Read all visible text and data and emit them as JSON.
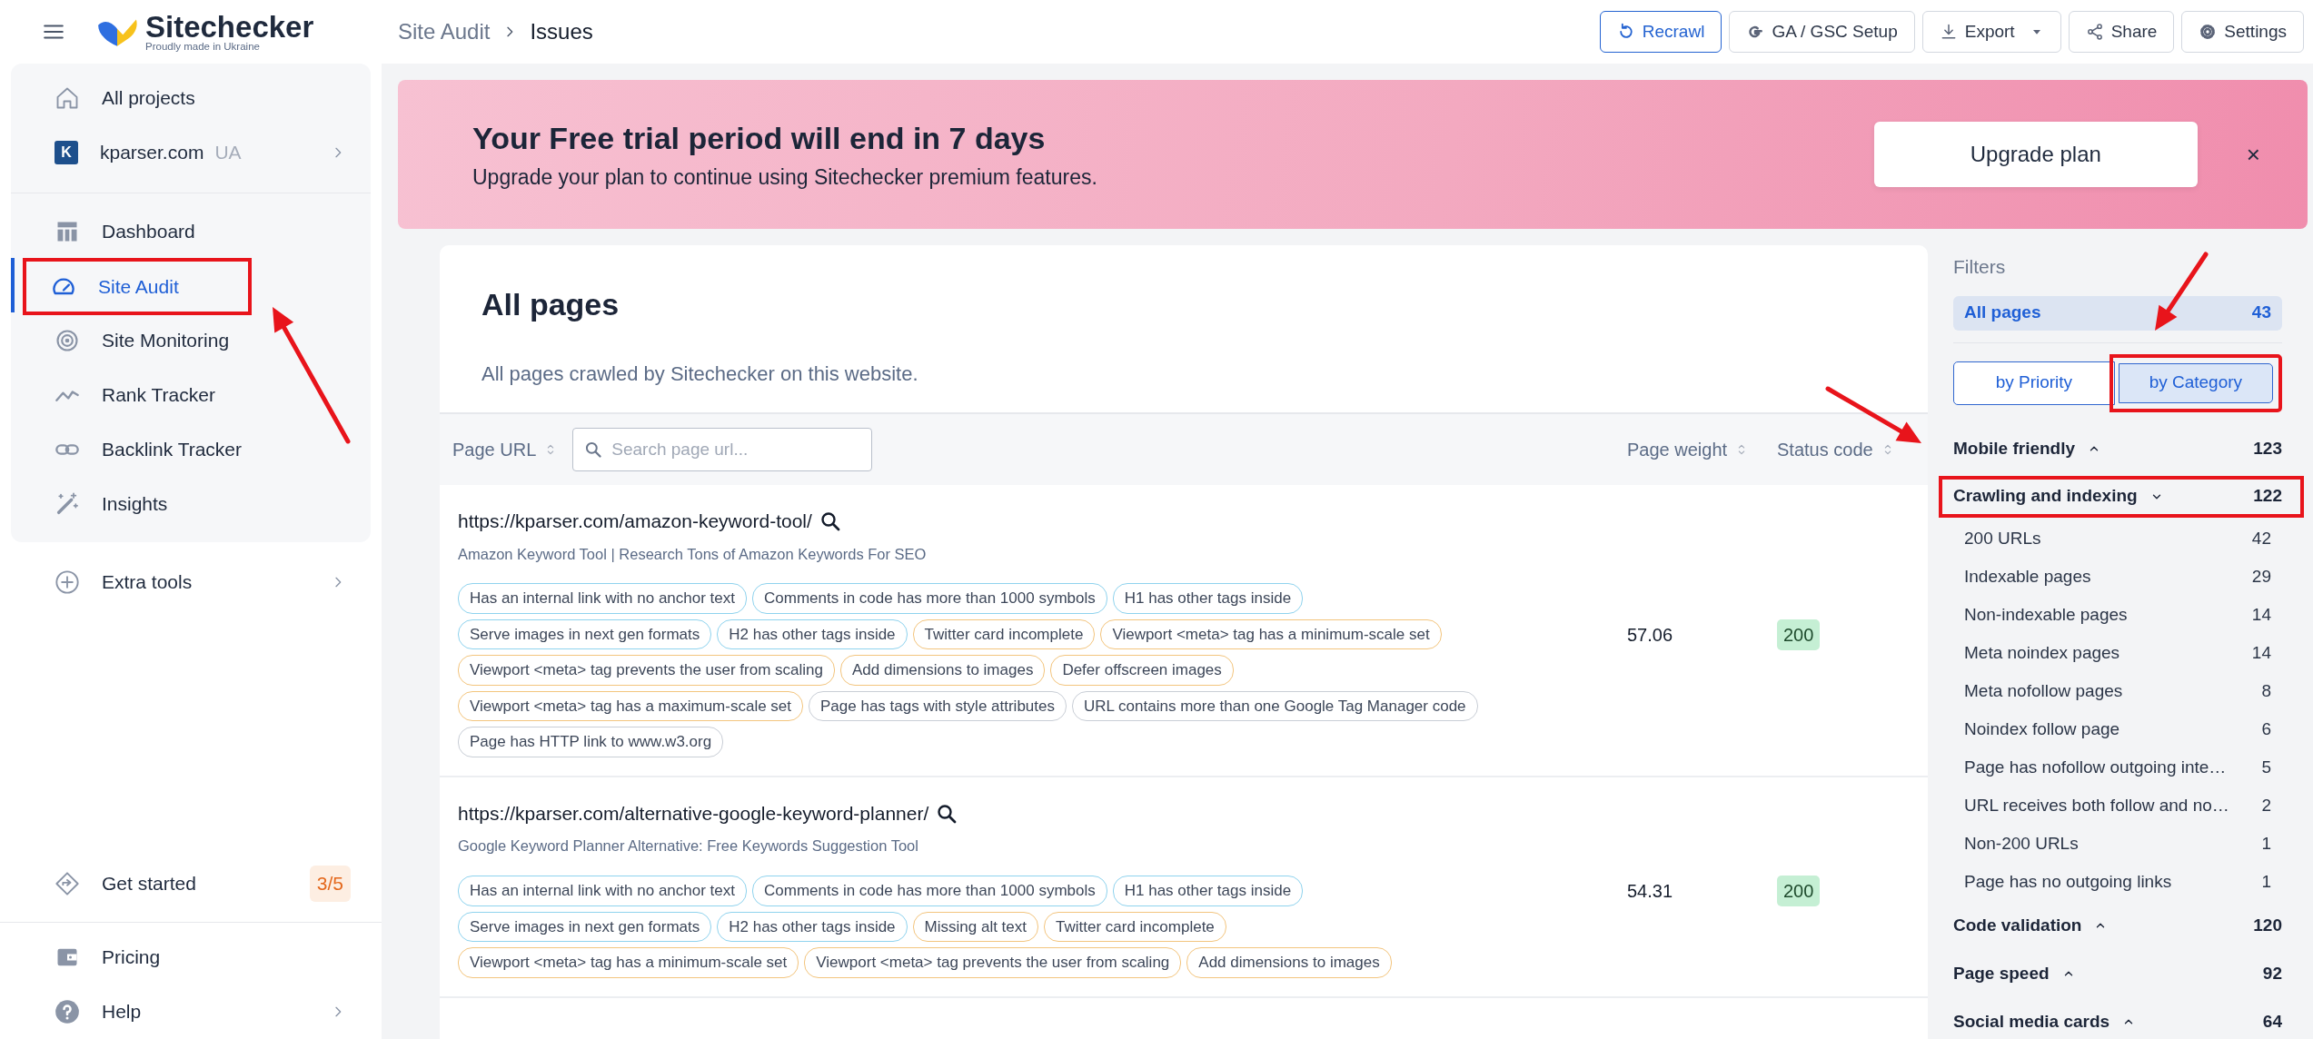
{
  "header": {
    "brand": "Sitechecker",
    "tagline": "Proudly made in Ukraine",
    "breadcrumb": [
      "Site Audit",
      "Issues"
    ],
    "buttons": [
      {
        "label": "Recrawl",
        "kind": "refresh",
        "primary": true
      },
      {
        "label": "GA / GSC Setup",
        "kind": "g",
        "primary": false
      },
      {
        "label": "Export",
        "kind": "download",
        "primary": false,
        "dropdown": true
      },
      {
        "label": "Share",
        "kind": "share",
        "primary": false
      },
      {
        "label": "Settings",
        "kind": "gear",
        "primary": false
      }
    ]
  },
  "sidebar": {
    "top": [
      {
        "label": "All projects",
        "kind": "home"
      }
    ],
    "project": {
      "initial": "K",
      "name": "kparser.com",
      "region": "UA"
    },
    "nav": [
      {
        "label": "Dashboard",
        "kind": "table",
        "selected": false,
        "highlighted": false
      },
      {
        "label": "Site Audit",
        "kind": "gauge",
        "selected": true,
        "highlighted": true
      },
      {
        "label": "Site Monitoring",
        "kind": "target",
        "selected": false,
        "highlighted": false
      },
      {
        "label": "Rank Tracker",
        "kind": "trend",
        "selected": false,
        "highlighted": false
      },
      {
        "label": "Backlink Tracker",
        "kind": "link",
        "selected": false,
        "highlighted": false
      },
      {
        "label": "Insights",
        "kind": "wand",
        "selected": false,
        "highlighted": false
      }
    ],
    "extra": {
      "label": "Extra tools",
      "kind": "plus"
    },
    "get_started": {
      "label": "Get started",
      "kind": "diamond",
      "progress": "3/5"
    },
    "bottom": [
      {
        "label": "Pricing",
        "kind": "wallet",
        "chevron": false
      },
      {
        "label": "Help",
        "kind": "help",
        "chevron": true
      }
    ]
  },
  "banner": {
    "title": "Your Free trial period will end in 7 days",
    "text": "Upgrade your plan to continue using Sitechecker premium features.",
    "button": "Upgrade plan",
    "close": "×"
  },
  "pages": {
    "title": "All pages",
    "subtitle": "All pages crawled by Sitechecker on this website.",
    "columns": [
      "Page URL",
      "Page weight",
      "Status code"
    ],
    "search": {
      "placeholder": "Search page url..."
    },
    "rows": [
      {
        "url": "https://kparser.com/amazon-keyword-tool/",
        "title": "Amazon Keyword Tool | Research Tons of Amazon Keywords For SEO",
        "weight": "57.06",
        "status": "200",
        "tag_lines": [
          [
            {
              "label": "Has an internal link with no anchor text",
              "color": "#8fd3ee"
            },
            {
              "label": "Comments in code has more than 1000 symbols",
              "color": "#8fd3ee"
            },
            {
              "label": "H1 has other tags inside",
              "color": "#8fd3ee"
            }
          ],
          [
            {
              "label": "Serve images in next gen formats",
              "color": "#8fd3ee"
            },
            {
              "label": "H2 has other tags inside",
              "color": "#8fd3ee"
            },
            {
              "label": "Twitter card incomplete",
              "color": "#f3c57e"
            },
            {
              "label": "Viewport <meta> tag has a minimum-scale set",
              "color": "#f3c57e"
            }
          ],
          [
            {
              "label": "Viewport <meta> tag prevents the user from scaling",
              "color": "#f3c57e"
            },
            {
              "label": "Add dimensions to images",
              "color": "#f3c57e"
            },
            {
              "label": "Defer offscreen images",
              "color": "#f3c57e"
            }
          ],
          [
            {
              "label": "Viewport <meta> tag has a maximum-scale set",
              "color": "#f3c57e"
            },
            {
              "label": "Page has tags with style attributes",
              "color": "#c9ced6"
            },
            {
              "label": "URL contains more than one Google Tag Manager code",
              "color": "#c9ced6"
            }
          ],
          [
            {
              "label": "Page has HTTP link to www.w3.org",
              "color": "#c9ced6"
            }
          ]
        ]
      },
      {
        "url": "https://kparser.com/alternative-google-keyword-planner/",
        "title": "Google Keyword Planner Alternative: Free Keywords Suggestion Tool",
        "weight": "54.31",
        "status": "200",
        "tag_lines": [
          [
            {
              "label": "Has an internal link with no anchor text",
              "color": "#8fd3ee"
            },
            {
              "label": "Comments in code has more than 1000 symbols",
              "color": "#8fd3ee"
            },
            {
              "label": "H1 has other tags inside",
              "color": "#8fd3ee"
            }
          ],
          [
            {
              "label": "Serve images in next gen formats",
              "color": "#8fd3ee"
            },
            {
              "label": "H2 has other tags inside",
              "color": "#8fd3ee"
            },
            {
              "label": "Missing alt text",
              "color": "#f3c57e"
            },
            {
              "label": "Twitter card incomplete",
              "color": "#f3c57e"
            }
          ],
          [
            {
              "label": "Viewport <meta> tag has a minimum-scale set",
              "color": "#f3c57e"
            },
            {
              "label": "Viewport <meta> tag prevents the user from scaling",
              "color": "#f3c57e"
            },
            {
              "label": "Add dimensions to images",
              "color": "#f3c57e"
            }
          ]
        ]
      }
    ]
  },
  "filters": {
    "title": "Filters",
    "all": {
      "label": "All pages",
      "count": "43",
      "selected": true
    },
    "toggle": [
      {
        "label": "by Priority",
        "selected": false,
        "highlighted": false
      },
      {
        "label": "by Category",
        "selected": true,
        "highlighted": true
      }
    ],
    "categories": [
      {
        "label": "Mobile friendly",
        "count": "123",
        "expanded": false,
        "highlighted": false
      },
      {
        "label": "Crawling and indexing",
        "count": "122",
        "expanded": true,
        "highlighted": true,
        "children": [
          {
            "label": "200 URLs",
            "count": "42"
          },
          {
            "label": "Indexable pages",
            "count": "29"
          },
          {
            "label": "Non-indexable pages",
            "count": "14"
          },
          {
            "label": "Meta noindex pages",
            "count": "14"
          },
          {
            "label": "Meta nofollow pages",
            "count": "8"
          },
          {
            "label": "Noindex follow page",
            "count": "6"
          },
          {
            "label": "Page has nofollow outgoing inte…",
            "count": "5"
          },
          {
            "label": "URL receives both follow and no…",
            "count": "2"
          },
          {
            "label": "Non-200 URLs",
            "count": "1"
          },
          {
            "label": "Page has no outgoing links",
            "count": "1"
          }
        ]
      },
      {
        "label": "Code validation",
        "count": "120",
        "expanded": false,
        "highlighted": false
      },
      {
        "label": "Page speed",
        "count": "92",
        "expanded": false,
        "highlighted": false
      },
      {
        "label": "Social media cards",
        "count": "64",
        "expanded": false,
        "highlighted": false
      }
    ]
  }
}
